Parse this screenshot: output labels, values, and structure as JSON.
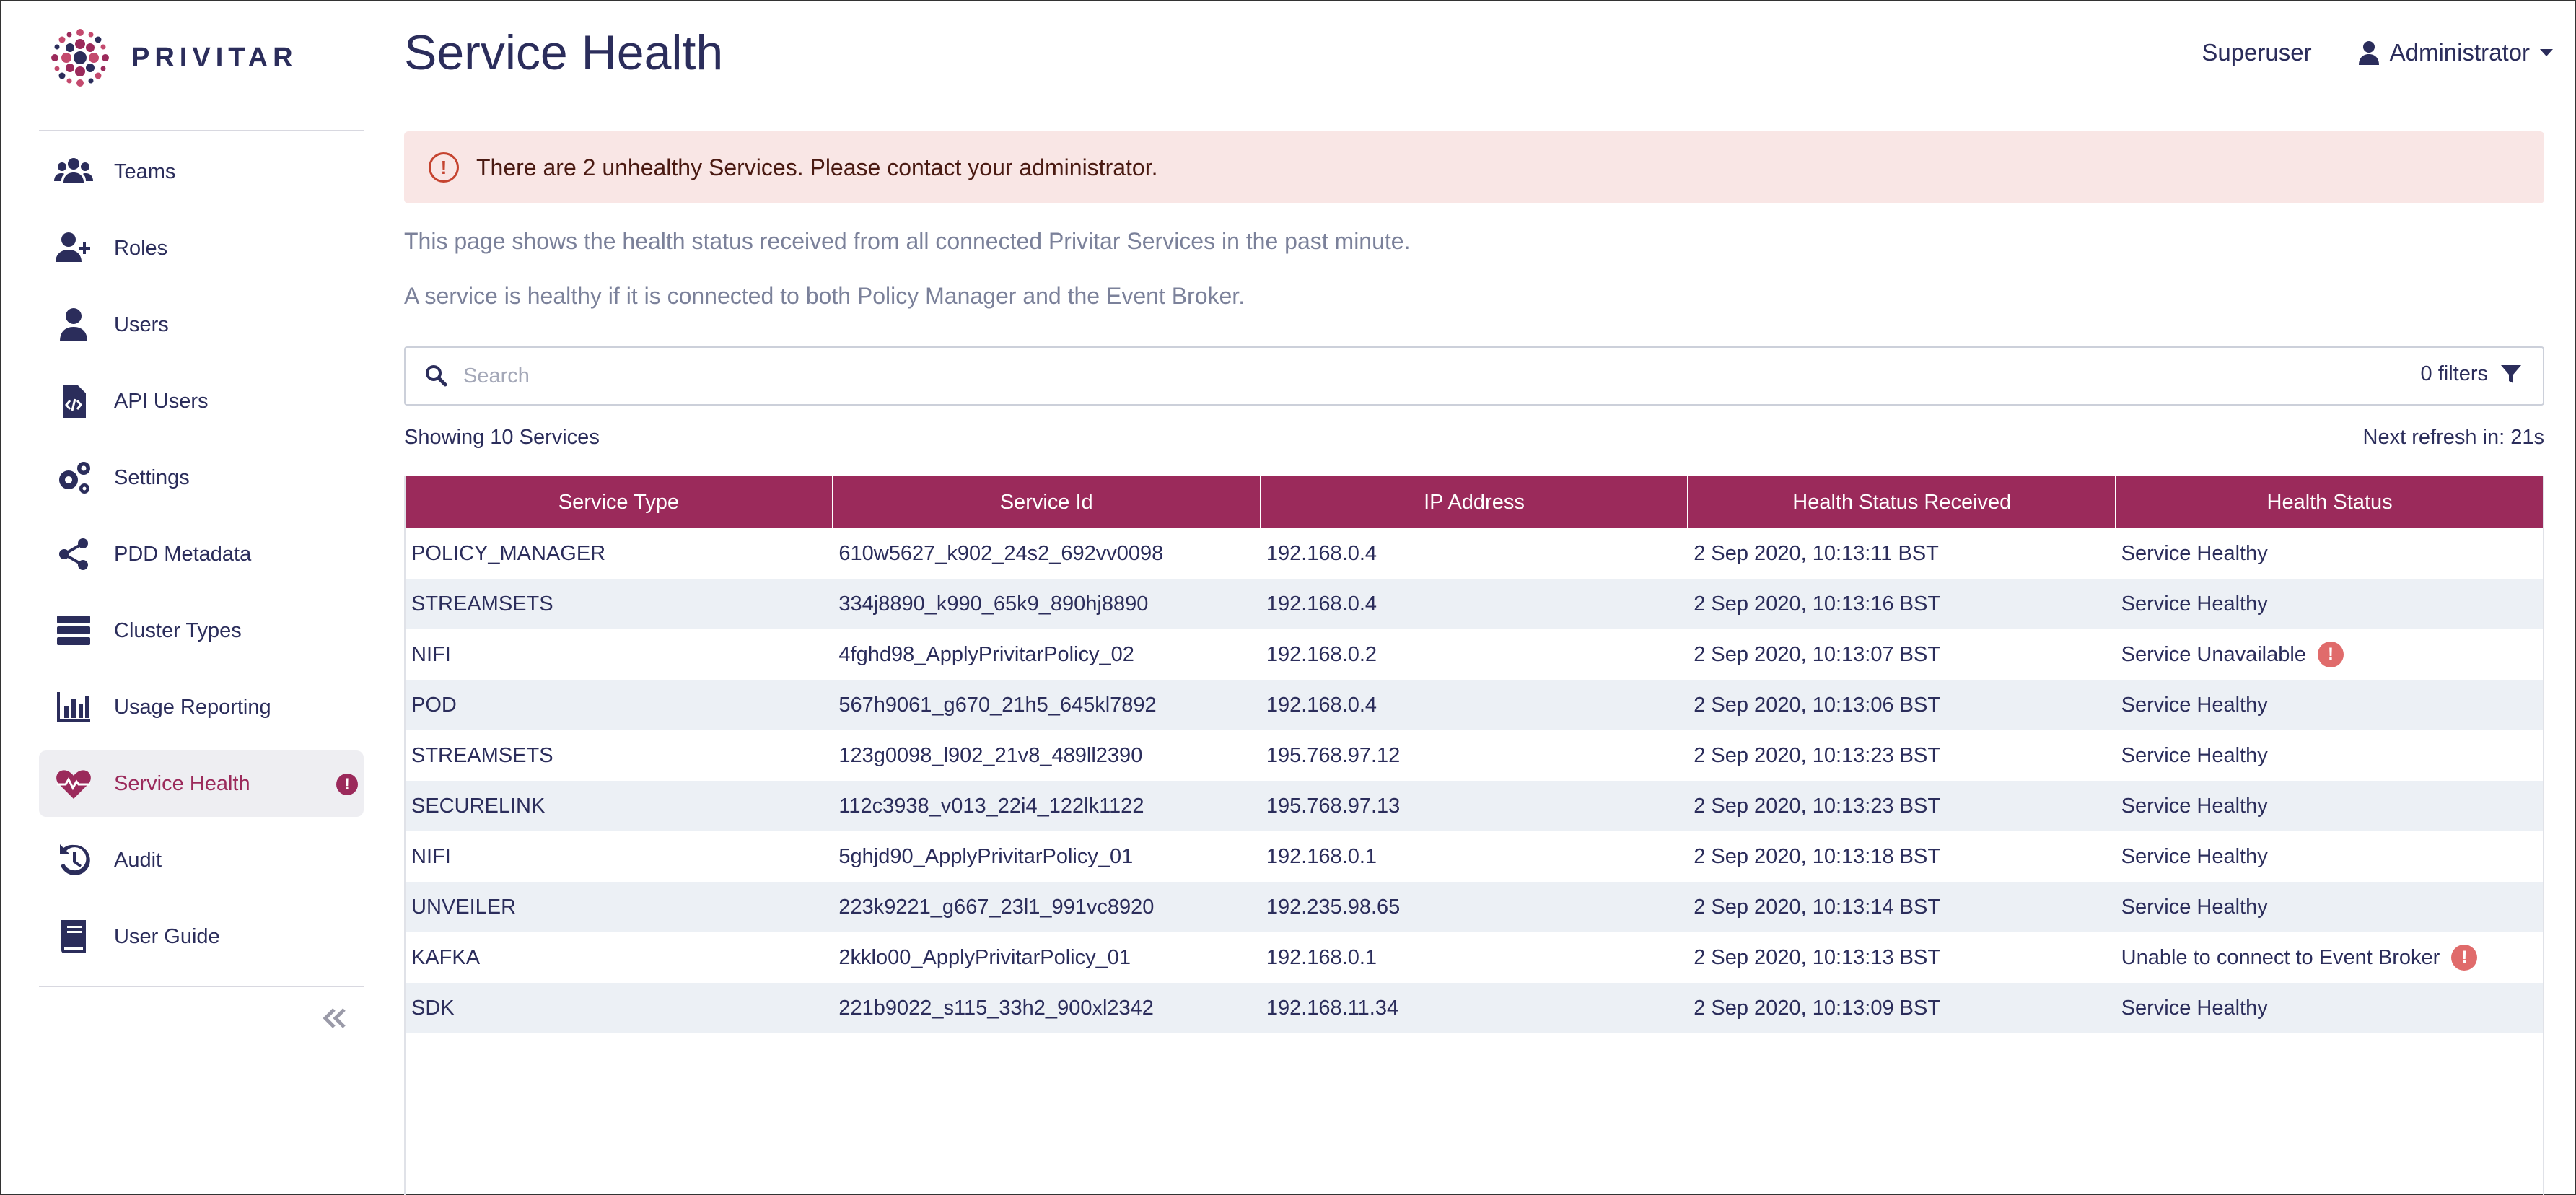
{
  "brand": {
    "name": "PRIVITAR"
  },
  "header": {
    "title": "Service Health",
    "superuser_label": "Superuser",
    "user_label": "Administrator"
  },
  "sidebar": {
    "items": [
      {
        "label": "Teams",
        "icon": "users-icon",
        "active": false
      },
      {
        "label": "Roles",
        "icon": "user-plus-icon",
        "active": false
      },
      {
        "label": "Users",
        "icon": "user-icon",
        "active": false
      },
      {
        "label": "API Users",
        "icon": "code-file-icon",
        "active": false
      },
      {
        "label": "Settings",
        "icon": "gears-icon",
        "active": false
      },
      {
        "label": "PDD Metadata",
        "icon": "share-icon",
        "active": false
      },
      {
        "label": "Cluster Types",
        "icon": "server-icon",
        "active": false
      },
      {
        "label": "Usage Reporting",
        "icon": "bar-chart-icon",
        "active": false
      },
      {
        "label": "Service Health",
        "icon": "heartbeat-icon",
        "active": true,
        "alert": "!"
      },
      {
        "label": "Audit",
        "icon": "history-icon",
        "active": false
      },
      {
        "label": "User Guide",
        "icon": "book-icon",
        "active": false
      }
    ]
  },
  "alert": {
    "icon": "!",
    "text": "There are 2 unhealthy Services. Please contact your administrator."
  },
  "description": {
    "line1": "This page shows the health status received from all connected Privitar Services in the past minute.",
    "line2": "A service is healthy if it is connected to both Policy Manager and the Event Broker."
  },
  "search": {
    "placeholder": "Search",
    "value": "",
    "filters_label": "0 filters"
  },
  "summary": {
    "showing": "Showing 10 Services",
    "refresh": "Next refresh in: 21s"
  },
  "table": {
    "columns": [
      "Service Type",
      "Service Id",
      "IP Address",
      "Health Status Received",
      "Health Status"
    ],
    "rows": [
      {
        "type": "POLICY_MANAGER",
        "id": "610w5627_k902_24s2_692vv0098",
        "ip": "192.168.0.4",
        "received": "2 Sep 2020, 10:13:11 BST",
        "status": "Service Healthy",
        "warn": false
      },
      {
        "type": "STREAMSETS",
        "id": "334j8890_k990_65k9_890hj8890",
        "ip": "192.168.0.4",
        "received": "2 Sep 2020, 10:13:16 BST",
        "status": "Service Healthy",
        "warn": false
      },
      {
        "type": "NIFI",
        "id": "4fghd98_ApplyPrivitarPolicy_02",
        "ip": "192.168.0.2",
        "received": "2 Sep 2020, 10:13:07 BST",
        "status": "Service Unavailable",
        "warn": true
      },
      {
        "type": "POD",
        "id": "567h9061_g670_21h5_645kl7892",
        "ip": "192.168.0.4",
        "received": "2 Sep 2020, 10:13:06 BST",
        "status": "Service Healthy",
        "warn": false
      },
      {
        "type": "STREAMSETS",
        "id": "123g0098_l902_21v8_489ll2390",
        "ip": "195.768.97.12",
        "received": "2 Sep 2020, 10:13:23 BST",
        "status": "Service Healthy",
        "warn": false
      },
      {
        "type": "SECURELINK",
        "id": "112c3938_v013_22i4_122lk1122",
        "ip": "195.768.97.13",
        "received": "2 Sep 2020, 10:13:23 BST",
        "status": "Service Healthy",
        "warn": false
      },
      {
        "type": "NIFI",
        "id": "5ghjd90_ApplyPrivitarPolicy_01",
        "ip": "192.168.0.1",
        "received": "2 Sep 2020, 10:13:18 BST",
        "status": "Service Healthy",
        "warn": false
      },
      {
        "type": "UNVEILER",
        "id": "223k9221_g667_23l1_991vc8920",
        "ip": "192.235.98.65",
        "received": "2 Sep 2020, 10:13:14 BST",
        "status": "Service Healthy",
        "warn": false
      },
      {
        "type": "KAFKA",
        "id": "2kklo00_ApplyPrivitarPolicy_01",
        "ip": "192.168.0.1",
        "received": "2 Sep 2020, 10:13:13 BST",
        "status": "Unable to connect to Event Broker",
        "warn": true
      },
      {
        "type": "SDK",
        "id": "221b9022_s115_33h2_900xl2342",
        "ip": "192.168.11.34",
        "received": "2 Sep 2020, 10:13:09 BST",
        "status": "Service Healthy",
        "warn": false
      }
    ]
  },
  "colors": {
    "accent": "#9b2a5b",
    "text": "#2b2d5b",
    "alert_bg": "#f9e6e5",
    "row_alt": "#ecf0f5",
    "warn": "#e06b6b"
  }
}
